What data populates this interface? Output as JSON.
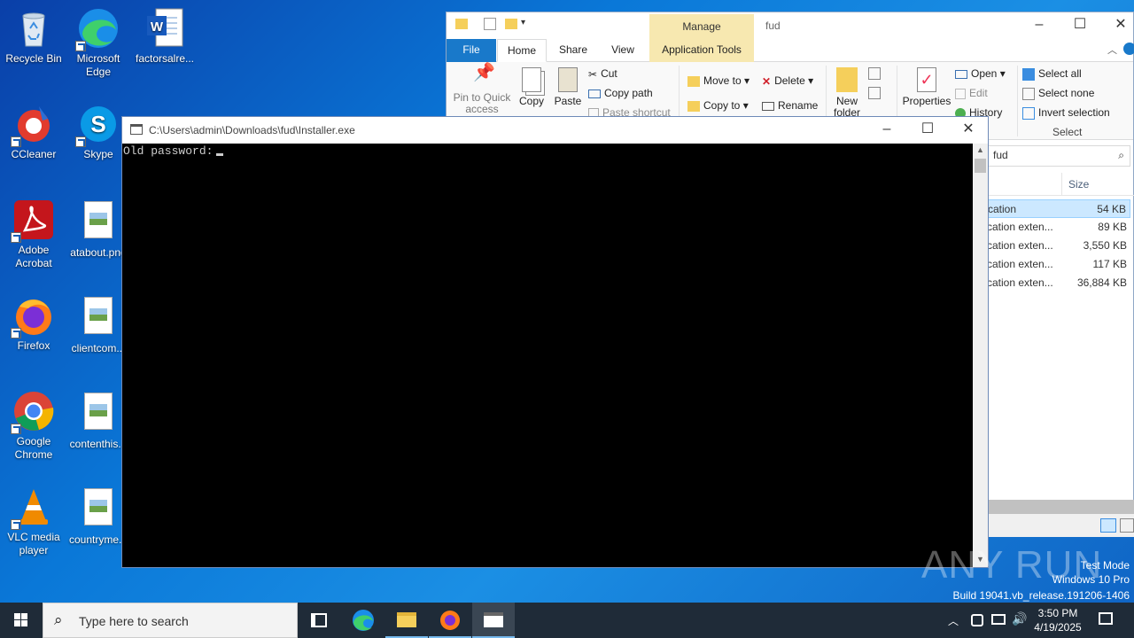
{
  "desktop": {
    "icons": [
      {
        "label": "Recycle Bin"
      },
      {
        "label": "Microsoft Edge"
      },
      {
        "label": "factorsalre..."
      },
      {
        "label": "CCleaner"
      },
      {
        "label": "Skype"
      },
      {
        "label": "Adobe Acrobat"
      },
      {
        "label": "atabout.png"
      },
      {
        "label": "Firefox"
      },
      {
        "label": "clientcom..."
      },
      {
        "label": "Google Chrome"
      },
      {
        "label": "contenthis..."
      },
      {
        "label": "VLC media player"
      },
      {
        "label": "countryme..."
      }
    ]
  },
  "explorer": {
    "title": "fud",
    "context_tab_group": "Manage",
    "tabs": {
      "file": "File",
      "home": "Home",
      "share": "Share",
      "view": "View",
      "app_tools": "Application Tools"
    },
    "ribbon": {
      "pin": "Pin to Quick access",
      "copy": "Copy",
      "paste": "Paste",
      "cut": "Cut",
      "copy_path": "Copy path",
      "paste_shortcut": "Paste shortcut",
      "move_to": "Move to",
      "copy_to": "Copy to",
      "delete": "Delete",
      "rename": "Rename",
      "new_folder": "New folder",
      "properties": "Properties",
      "open": "Open",
      "edit": "Edit",
      "history": "History",
      "select_all": "Select all",
      "select_none": "Select none",
      "invert_selection": "Invert selection",
      "select_group": "Select"
    },
    "search_value": "fud",
    "size_header": "Size",
    "rows": [
      {
        "type": "cation",
        "size": "54 KB"
      },
      {
        "type": "cation exten...",
        "size": "89 KB"
      },
      {
        "type": "cation exten...",
        "size": "3,550 KB"
      },
      {
        "type": "cation exten...",
        "size": "117 KB"
      },
      {
        "type": "cation exten...",
        "size": "36,884 KB"
      }
    ]
  },
  "console": {
    "title": "C:\\Users\\admin\\Downloads\\fud\\Installer.exe",
    "prompt": "Old password:"
  },
  "watermark": {
    "brand": "ANY RUN",
    "line1": "Test Mode",
    "line2": "Windows 10 Pro",
    "line3": "Build 19041.vb_release.191206-1406"
  },
  "taskbar": {
    "search_placeholder": "Type here to search",
    "time": "3:50 PM",
    "date": "4/19/2025"
  },
  "colors": {
    "desktop_accent": "#0a78d8",
    "taskbar": "#1f2b38",
    "ribbon_file_tab": "#1979ca",
    "manage_tab": "#f7e8b0"
  }
}
